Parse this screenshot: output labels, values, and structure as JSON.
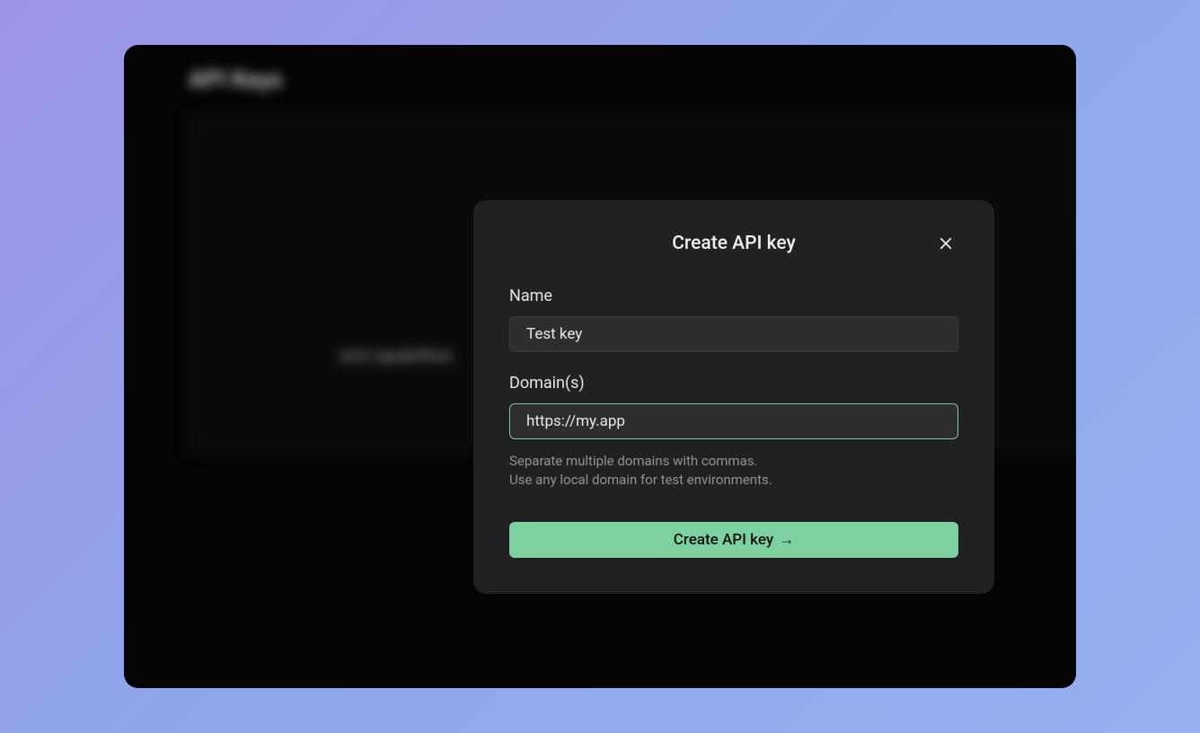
{
  "background": {
    "page_title": "API Keys",
    "description_text": "and capabilities"
  },
  "modal": {
    "title": "Create API key",
    "fields": {
      "name": {
        "label": "Name",
        "value": "Test key"
      },
      "domains": {
        "label": "Domain(s)",
        "value": "https://my.app",
        "help_line1": "Separate multiple domains with commas.",
        "help_line2": "Use any local domain for test environments."
      }
    },
    "submit_label": "Create API key",
    "submit_arrow": "→"
  },
  "colors": {
    "accent": "#7dd19f",
    "focus_border": "#6fcf97",
    "modal_bg": "#212123",
    "input_bg": "#2e2e30"
  }
}
